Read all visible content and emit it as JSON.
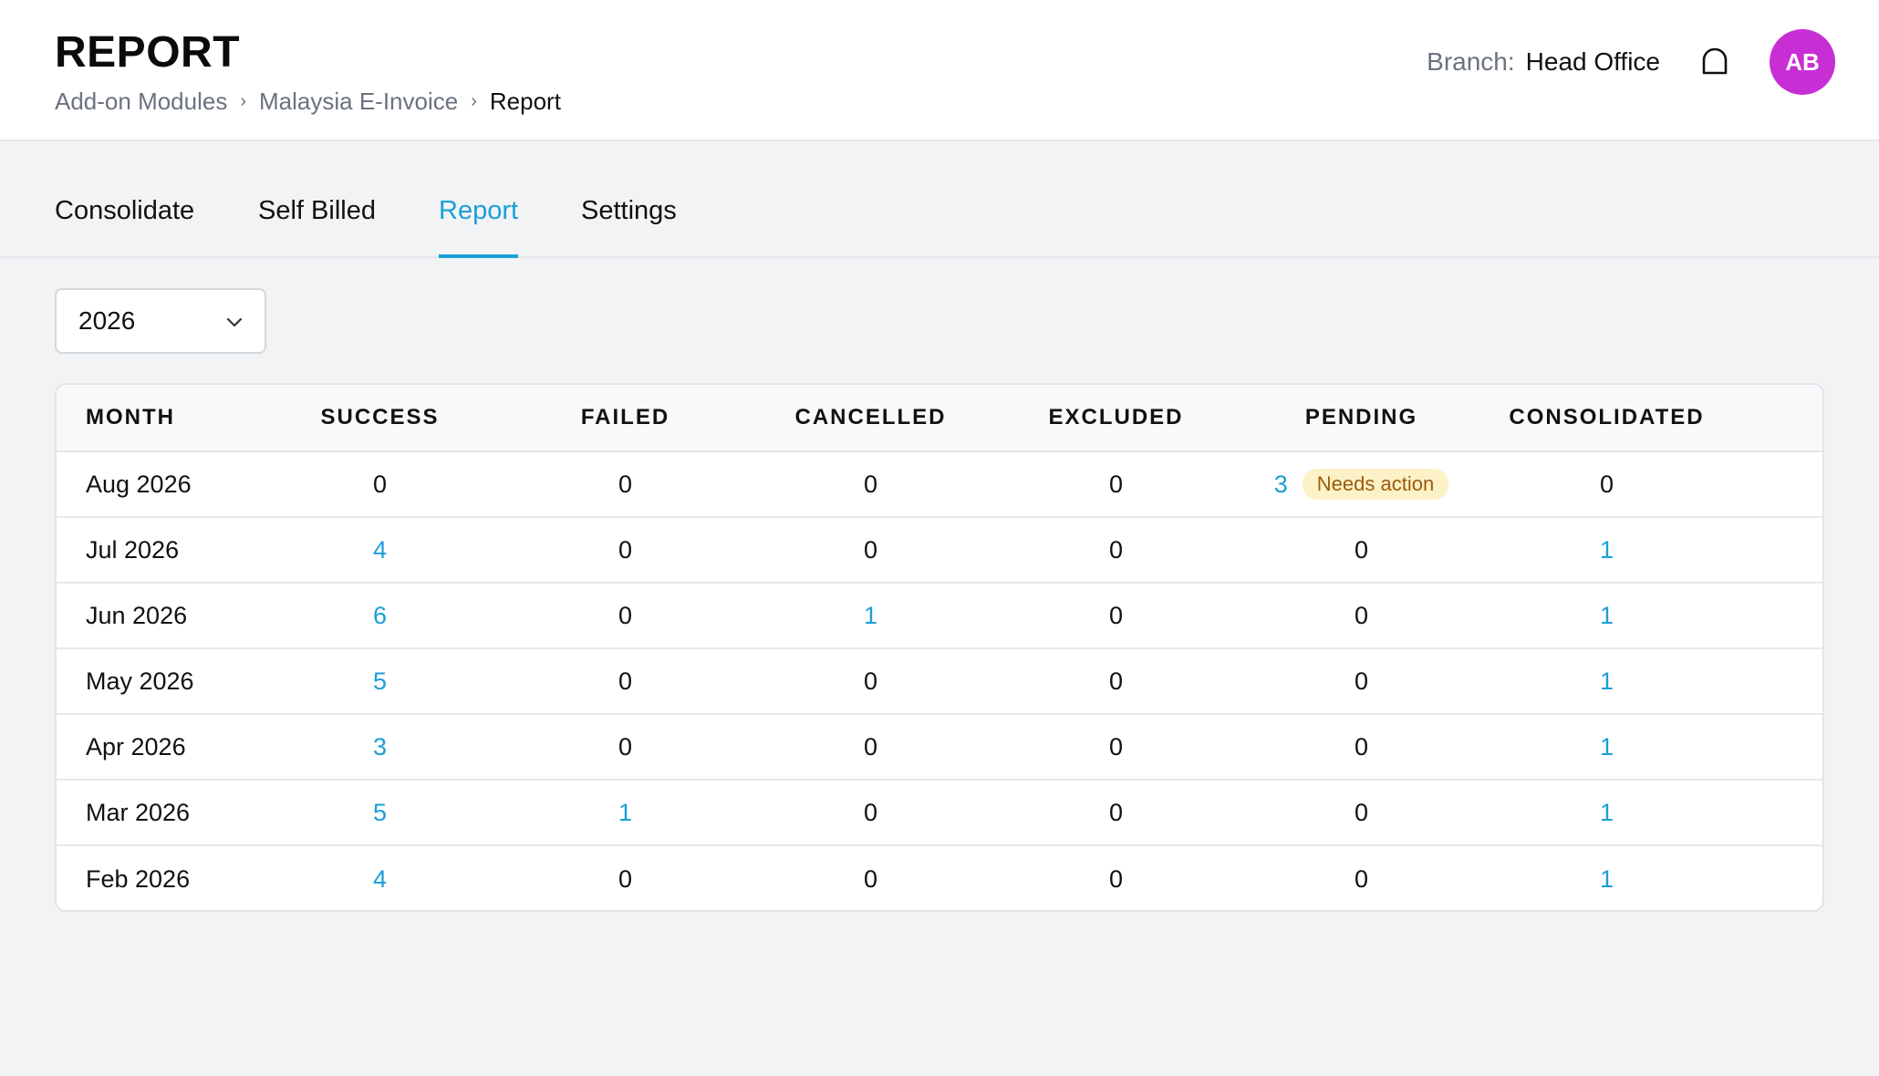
{
  "header": {
    "title": "REPORT",
    "breadcrumb": [
      "Add-on Modules",
      "Malaysia E-Invoice",
      "Report"
    ],
    "breadcrumb_separator": "›",
    "branch_label": "Branch:",
    "branch_value": "Head Office",
    "avatar_initials": "AB",
    "avatar_color": "#c72fd4",
    "notification_icon": "bell-icon"
  },
  "tabs": [
    {
      "label": "Consolidate",
      "active": false
    },
    {
      "label": "Self Billed",
      "active": false
    },
    {
      "label": "Report",
      "active": true
    },
    {
      "label": "Settings",
      "active": false
    }
  ],
  "accent_color": "#1a9fd8",
  "year_filter": {
    "value": "2026",
    "icon": "chevron-down-icon"
  },
  "table": {
    "columns": [
      "MONTH",
      "SUCCESS",
      "FAILED",
      "CANCELLED",
      "EXCLUDED",
      "PENDING",
      "CONSOLIDATED"
    ],
    "rows": [
      {
        "month": "Aug 2026",
        "success": "0",
        "failed": "0",
        "cancelled": "0",
        "excluded": "0",
        "pending": "3",
        "pending_badge": "Needs action",
        "consolidated": "0"
      },
      {
        "month": "Jul 2026",
        "success": "4",
        "failed": "0",
        "cancelled": "0",
        "excluded": "0",
        "pending": "0",
        "consolidated": "1"
      },
      {
        "month": "Jun 2026",
        "success": "6",
        "failed": "0",
        "cancelled": "1",
        "excluded": "0",
        "pending": "0",
        "consolidated": "1"
      },
      {
        "month": "May 2026",
        "success": "5",
        "failed": "0",
        "cancelled": "0",
        "excluded": "0",
        "pending": "0",
        "consolidated": "1"
      },
      {
        "month": "Apr 2026",
        "success": "3",
        "failed": "0",
        "cancelled": "0",
        "excluded": "0",
        "pending": "0",
        "consolidated": "1"
      },
      {
        "month": "Mar 2026",
        "success": "5",
        "failed": "1",
        "cancelled": "0",
        "excluded": "0",
        "pending": "0",
        "consolidated": "1"
      },
      {
        "month": "Feb 2026",
        "success": "4",
        "failed": "0",
        "cancelled": "0",
        "excluded": "0",
        "pending": "0",
        "consolidated": "1"
      }
    ]
  }
}
